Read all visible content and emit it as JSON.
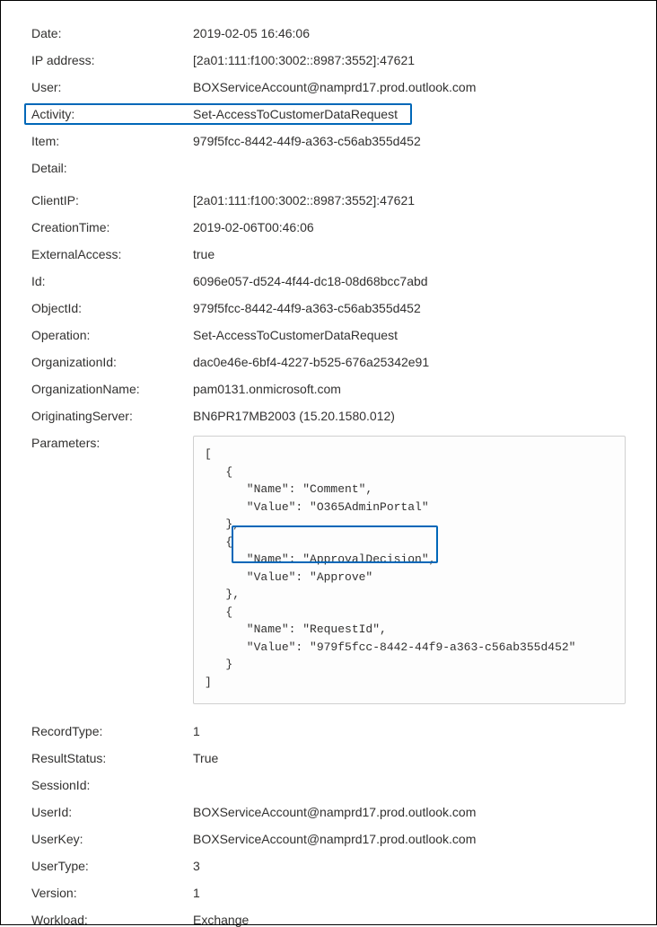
{
  "top": {
    "date_label": "Date:",
    "date_value": "2019-02-05 16:46:06",
    "ip_label": "IP address:",
    "ip_value": "[2a01:111:f100:3002::8987:3552]:47621",
    "user_label": "User:",
    "user_value": "BOXServiceAccount@namprd17.prod.outlook.com",
    "activity_label": "Activity:",
    "activity_value": "Set-AccessToCustomerDataRequest",
    "item_label": "Item:",
    "item_value": "979f5fcc-8442-44f9-a363-c56ab355d452",
    "detail_label": "Detail:"
  },
  "details": {
    "clientip_label": "ClientIP:",
    "clientip_value": "[2a01:111:f100:3002::8987:3552]:47621",
    "creationtime_label": "CreationTime:",
    "creationtime_value": "2019-02-06T00:46:06",
    "externalaccess_label": "ExternalAccess:",
    "externalaccess_value": "true",
    "id_label": "Id:",
    "id_value": "6096e057-d524-4f44-dc18-08d68bcc7abd",
    "objectid_label": "ObjectId:",
    "objectid_value": "979f5fcc-8442-44f9-a363-c56ab355d452",
    "operation_label": "Operation:",
    "operation_value": "Set-AccessToCustomerDataRequest",
    "organizationid_label": "OrganizationId:",
    "organizationid_value": "dac0e46e-6bf4-4227-b525-676a25342e91",
    "organizationname_label": "OrganizationName:",
    "organizationname_value": "pam0131.onmicrosoft.com",
    "originatingserver_label": "OriginatingServer:",
    "originatingserver_value": "BN6PR17MB2003 (15.20.1580.012)",
    "parameters_label": "Parameters:",
    "parameters_value": "[\n   {\n      \"Name\": \"Comment\",\n      \"Value\": \"O365AdminPortal\"\n   },\n   {\n      \"Name\": \"ApprovalDecision\",\n      \"Value\": \"Approve\"\n   },\n   {\n      \"Name\": \"RequestId\",\n      \"Value\": \"979f5fcc-8442-44f9-a363-c56ab355d452\"\n   }\n]",
    "recordtype_label": "RecordType:",
    "recordtype_value": "1",
    "resultstatus_label": "ResultStatus:",
    "resultstatus_value": "True",
    "sessionid_label": "SessionId:",
    "sessionid_value": "",
    "userid_label": "UserId:",
    "userid_value": "BOXServiceAccount@namprd17.prod.outlook.com",
    "userkey_label": "UserKey:",
    "userkey_value": "BOXServiceAccount@namprd17.prod.outlook.com",
    "usertype_label": "UserType:",
    "usertype_value": "3",
    "version_label": "Version:",
    "version_value": "1",
    "workload_label": "Workload:",
    "workload_value": "Exchange"
  }
}
